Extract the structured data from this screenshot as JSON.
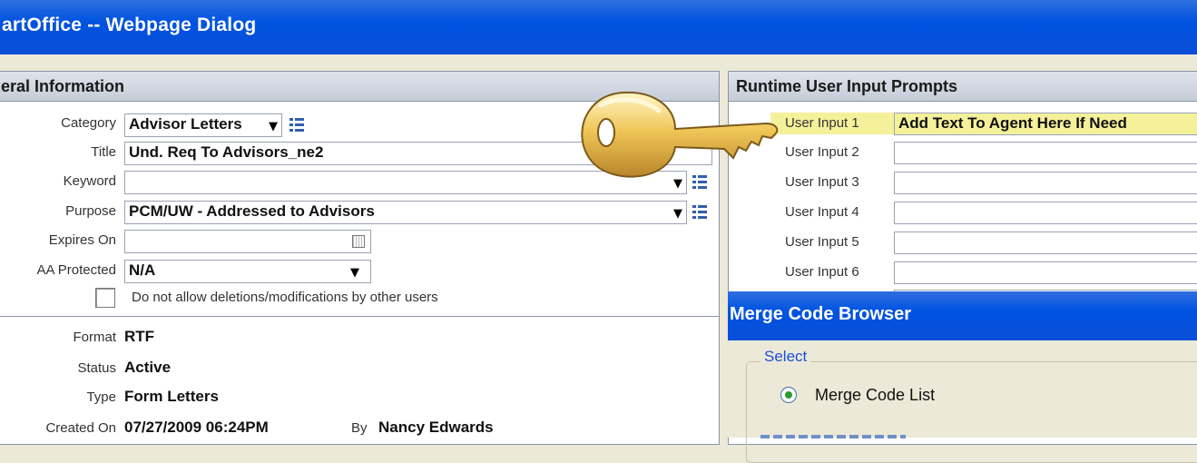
{
  "window": {
    "title": "artOffice -- Webpage Dialog"
  },
  "general": {
    "header": "eral Information",
    "category_label": "Category",
    "category_value": "Advisor Letters",
    "title_label": "Title",
    "title_value": "Und. Req To Advisors_ne2",
    "keyword_label": "Keyword",
    "keyword_value": "",
    "purpose_label": "Purpose",
    "purpose_value": "PCM/UW - Addressed to Advisors",
    "expires_label": "Expires On",
    "expires_value": "",
    "protected_label": "AA Protected",
    "protected_value": "N/A",
    "no_delete_label": "Do not allow deletions/modifications by other users",
    "no_delete_checked": false,
    "format_label": "Format",
    "format_value": "RTF",
    "status_label": "Status",
    "status_value": "Active",
    "type_label": "Type",
    "type_value": "Form Letters",
    "created_label": "Created On",
    "created_value": "07/27/2009 06:24PM",
    "by_label": "By",
    "by_value": "Nancy Edwards"
  },
  "runtime": {
    "header": "Runtime User Input Prompts",
    "inputs": [
      {
        "label": "User Input 1",
        "value": "Add Text To Agent Here If Need",
        "highlight": "#f5f19a"
      },
      {
        "label": "User Input 2",
        "value": ""
      },
      {
        "label": "User Input 3",
        "value": ""
      },
      {
        "label": "User Input 4",
        "value": ""
      },
      {
        "label": "User Input 5",
        "value": ""
      },
      {
        "label": "User Input 6",
        "value": ""
      }
    ]
  },
  "merge_browser": {
    "title": "Merge Code Browser",
    "group_label": "Select",
    "radio_label": "Merge Code List",
    "radio_selected": true
  },
  "colors": {
    "titlebar": "#0053e1",
    "accent_radio": "#2a9d2a",
    "key": "#e8b84a"
  },
  "icons": {
    "key": "key-icon",
    "dropdown": "chevron-down-icon",
    "list": "list-icon",
    "calendar": "calendar-icon"
  }
}
